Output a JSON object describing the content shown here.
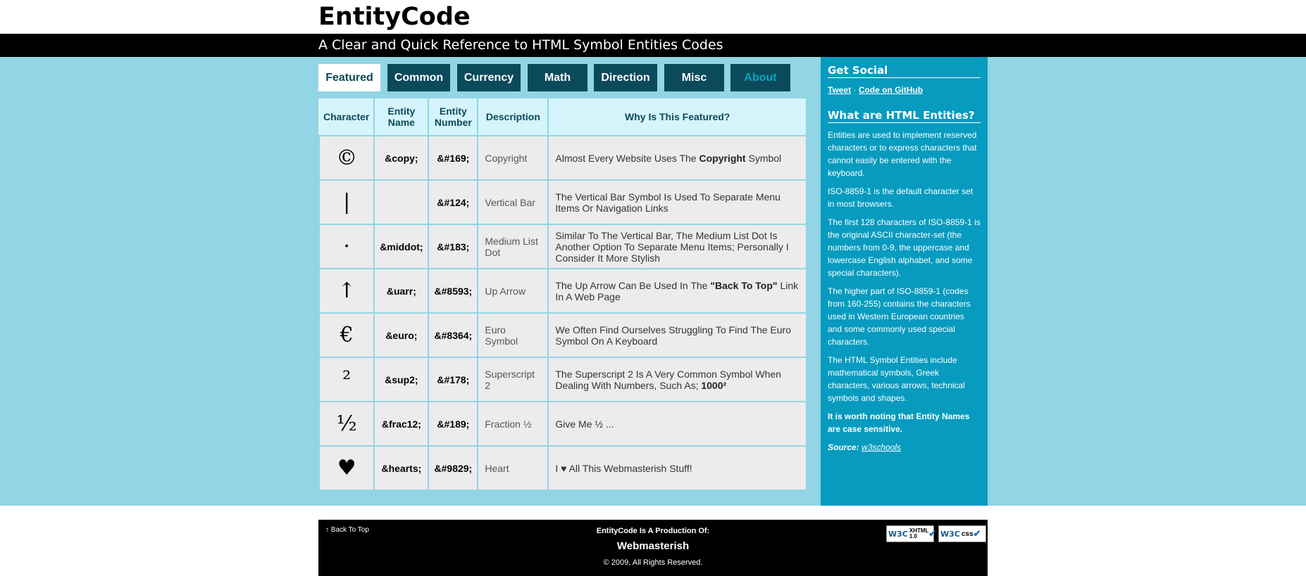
{
  "header": {
    "title": "EntityCode",
    "tagline": "A Clear and Quick Reference to HTML Symbol Entities Codes"
  },
  "nav": {
    "tabs": [
      {
        "label": "Featured",
        "active": true
      },
      {
        "label": "Common"
      },
      {
        "label": "Currency"
      },
      {
        "label": "Math"
      },
      {
        "label": "Direction"
      },
      {
        "label": "Misc"
      },
      {
        "label": "About"
      }
    ]
  },
  "table": {
    "headers": [
      "Character",
      "Entity Name",
      "Entity Number",
      "Description",
      "Why Is This Featured?"
    ],
    "rows": [
      {
        "char": "©",
        "name": "&copy;",
        "number": "&#169;",
        "description": "Copyright",
        "why_pre": "Almost Every Website Uses The ",
        "why_bold": "Copyright",
        "why_post": " Symbol"
      },
      {
        "char": "|",
        "name": "",
        "number": "&#124;",
        "description": "Vertical Bar",
        "why_pre": "The Vertical Bar Symbol Is Used To Separate Menu Items Or Navigation Links",
        "why_bold": "",
        "why_post": ""
      },
      {
        "char": "·",
        "name": "&middot;",
        "number": "&#183;",
        "description": "Medium List Dot",
        "why_pre": "Similar To The Vertical Bar, The Medium List Dot Is Another Option To Separate Menu Items; Personally I Consider It More Stylish",
        "why_bold": "",
        "why_post": ""
      },
      {
        "char": "↑",
        "name": "&uarr;",
        "number": "&#8593;",
        "description": "Up Arrow",
        "why_pre": "The Up Arrow Can Be Used In The ",
        "why_bold": "\"Back To Top\"",
        "why_post": " Link In A Web Page"
      },
      {
        "char": "€",
        "name": "&euro;",
        "number": "&#8364;",
        "description": "Euro Symbol",
        "why_pre": "We Often Find Ourselves Struggling To Find The Euro Symbol On A Keyboard",
        "why_bold": "",
        "why_post": ""
      },
      {
        "char": "²",
        "name": "&sup2;",
        "number": "&#178;",
        "description": "Superscript 2",
        "why_pre": "The Superscript 2 Is A Very Common Symbol When Dealing With Numbers, Such As; ",
        "why_bold": "1000²",
        "why_post": ""
      },
      {
        "char": "½",
        "name": "&frac12;",
        "number": "&#189;",
        "description": "Fraction ½",
        "why_pre": "Give Me ½ ...",
        "why_bold": "",
        "why_post": ""
      },
      {
        "char": "♥",
        "name": "&hearts;",
        "number": "&#9829;",
        "description": "Heart",
        "why_pre": "I ♥ All This Webmasterish Stuff!",
        "why_bold": "",
        "why_post": ""
      }
    ]
  },
  "sidebar": {
    "social_heading": "Get Social",
    "tweet_label": "Tweet",
    "separator": "·",
    "github_label": "Code on GitHub",
    "entities_heading": "What are HTML Entities?",
    "paragraphs": [
      "Entities are used to implement reserved characters or to express characters that cannot easily be entered with the keyboard.",
      "ISO-8859-1 is the default character set in most browsers.",
      "The first 128 characters of ISO-8859-1 is the original ASCII character-set (the numbers from 0-9, the uppercase and lowercase English alphabet, and some special characters).",
      "The higher part of ISO-8859-1 (codes from 160-255) contains the characters used in Western European countries and some commonly used special characters.",
      "The HTML Symbol Entities include mathematical symbols, Greek characters, various arrows, technical symbols and shapes."
    ],
    "note": "It is worth noting that Entity Names are case sensitive.",
    "source_label": "Source:",
    "source_link": "w3schools"
  },
  "footer": {
    "back_to_top": "↑ Back To Top",
    "production": "EntityCode Is A Production Of:",
    "logo_text": "Webmasterish",
    "copyright": "© 2009, All Rights Reserved.",
    "badge_xhtml": "XHTML 1.0",
    "badge_css": "css",
    "badge_w3c": "W3C"
  }
}
